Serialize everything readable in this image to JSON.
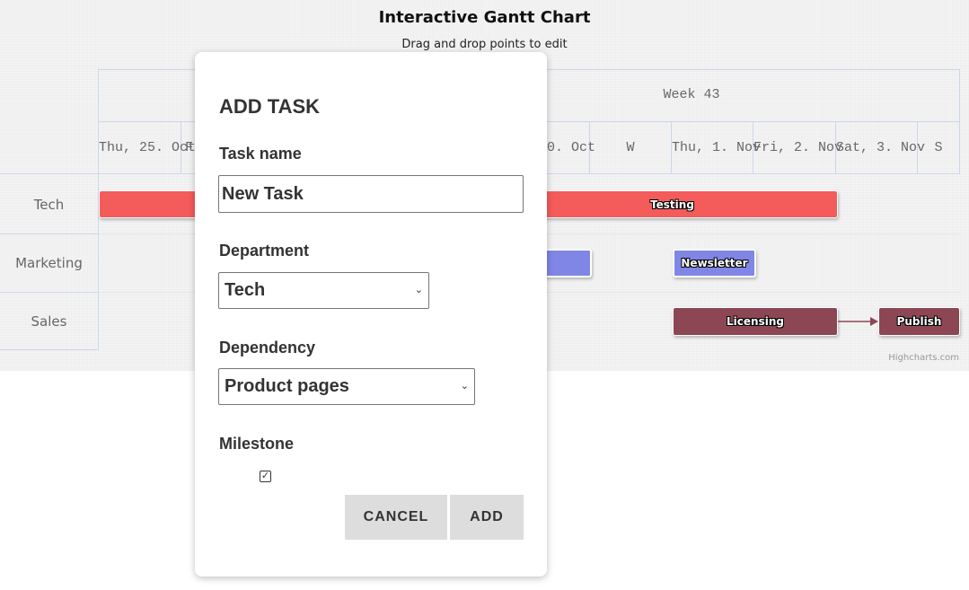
{
  "chart": {
    "title": "Interactive Gantt Chart",
    "subtitle": "Drag and drop points to edit",
    "credit": "Highcharts.com",
    "week_label": "Week 43",
    "day_labels": [
      "Thu, 25. Oct",
      "F",
      "30. Oct",
      "W",
      "Thu, 1. Nov",
      "Fri, 2. Nov",
      "Sat, 3. Nov",
      "S"
    ],
    "categories": [
      "Tech",
      "Marketing",
      "Sales"
    ],
    "tasks": [
      {
        "name": "Testing",
        "department": "Tech",
        "color": "#f45b5b"
      },
      {
        "name": "",
        "department": "Marketing",
        "color": "#7f86e6"
      },
      {
        "name": "Newsletter",
        "department": "Marketing",
        "color": "#7f86e6"
      },
      {
        "name": "Licensing",
        "department": "Sales",
        "color": "#8d4654"
      },
      {
        "name": "Publish",
        "department": "Sales",
        "color": "#8d4654"
      }
    ]
  },
  "dialog": {
    "title": "ADD TASK",
    "task_name_label": "Task name",
    "task_name_value": "New Task",
    "department_label": "Department",
    "department_value": "Tech",
    "dependency_label": "Dependency",
    "dependency_value": "Product pages",
    "milestone_label": "Milestone",
    "milestone_checked": true,
    "cancel_label": "CANCEL",
    "add_label": "ADD"
  }
}
